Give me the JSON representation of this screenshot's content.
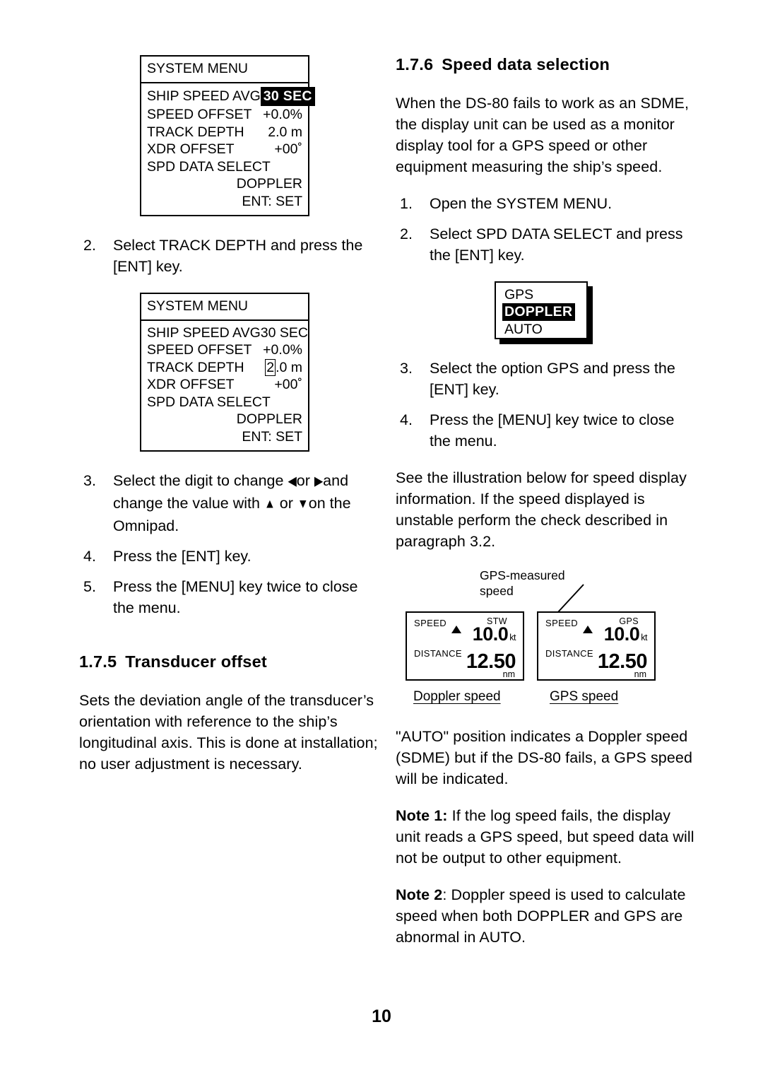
{
  "page": {
    "folio": "10"
  },
  "left_column": {
    "menu_box_1": {
      "title": "SYSTEM MENU",
      "rows": [
        {
          "label": "SHIP SPEED AVG",
          "value": "30 SEC",
          "highlight": true
        },
        {
          "label": "SPEED OFFSET",
          "value": "+0.0%",
          "highlight": false
        },
        {
          "label": "TRACK DEPTH",
          "value": "2.0 m",
          "highlight": false
        },
        {
          "label": "XDR OFFSET",
          "value": "+00˚",
          "highlight": false
        },
        {
          "label": "SPD DATA  SELECT",
          "value": "",
          "highlight": false
        }
      ],
      "footer_lines": [
        "DOPPLER",
        "ENT: SET"
      ]
    },
    "step_2": {
      "marker": "2.",
      "text": "Select TRACK DEPTH and press the [ENT] key."
    },
    "menu_box_2": {
      "title": "SYSTEM MENU",
      "rows": [
        {
          "label": "SHIP SPEED AVG",
          "value": "30 SEC",
          "cursor": false
        },
        {
          "label": "SPEED OFFSET",
          "value": "+0.0%",
          "cursor": false
        },
        {
          "label": "TRACK DEPTH",
          "value": "2.0 m",
          "cursor_digit": "2",
          "cursor_rest": ".0 m",
          "cursor": true
        },
        {
          "label": "XDR OFFSET",
          "value": "+00˚",
          "cursor": false
        },
        {
          "label": "SPD DATA  SELECT",
          "value": "",
          "cursor": false
        }
      ],
      "footer_lines": [
        "DOPPLER",
        "ENT: SET"
      ]
    },
    "step_3": {
      "marker": "3.",
      "part1": "Select the digit to change",
      "arrow_left": "◀",
      "mid1": "or",
      "arrow_right": "▶",
      "part2": "and change the value with",
      "arrow_up": "▲",
      "mid2": "or",
      "arrow_down": "▼",
      "part3": "on the Omnipad."
    },
    "step_4": {
      "marker": "4.",
      "text": "Press the [ENT] key."
    },
    "step_5": {
      "marker": "5.",
      "text": "Press the [MENU] key twice to close the menu."
    },
    "heading_175": {
      "number": "1.7.5",
      "title": "Transducer offset"
    },
    "para_175": "Sets the deviation angle of the transducer’s orientation with reference to the ship’s longitudinal axis. This is done at installation; no user adjustment is necessary."
  },
  "right_column": {
    "heading_176": {
      "number": "1.7.6",
      "title": "Speed data selection"
    },
    "para_intro": "When the DS-80 fails to work as an SDME, the display unit can be used as a monitor display tool for a GPS speed or other equipment measuring the ship’s speed.",
    "step_1": {
      "marker": "1.",
      "text": "Open the SYSTEM MENU."
    },
    "step_2": {
      "marker": "2.",
      "text": "Select SPD DATA SELECT and press the [ENT] key."
    },
    "select_box": {
      "options": [
        "GPS",
        "DOPPLER",
        "AUTO"
      ],
      "selected": "DOPPLER"
    },
    "step_3": {
      "marker": "3.",
      "text": "Select the option GPS and press the [ENT] key."
    },
    "step_4": {
      "marker": "4.",
      "text": "Press the [MENU] key twice to close the menu."
    },
    "para_see": "See the illustration below for speed display information. If the speed displayed is unstable perform the check described in paragraph 3.2.",
    "illustration": {
      "callout_line1": "GPS-measured",
      "callout_line2": "speed",
      "display_left": {
        "speed_label": "SPEED",
        "distance_label": "DISTANCE",
        "source": "STW",
        "speed_value": "10.0",
        "speed_unit": "kt",
        "distance_value": "12.50",
        "distance_unit": "nm"
      },
      "display_right": {
        "speed_label": "SPEED",
        "distance_label": "DISTANCE",
        "source": "GPS",
        "speed_value": "10.0",
        "speed_unit": "kt",
        "distance_value": "12.50",
        "distance_unit": "nm"
      },
      "caption_left": "Doppler speed",
      "caption_right": "GPS speed"
    },
    "para_auto": "\"AUTO\" position indicates a Doppler speed (SDME) but if the DS-80 fails, a GPS speed will be indicated.",
    "note_1": {
      "label": "Note 1:",
      "text": " If the log speed fails, the display unit reads a GPS speed, but speed data will not be output to other equipment."
    },
    "note_2": {
      "label": "Note 2",
      "text": ": Doppler speed is used to calculate speed when both DOPPLER and GPS are abnormal in AUTO."
    }
  }
}
